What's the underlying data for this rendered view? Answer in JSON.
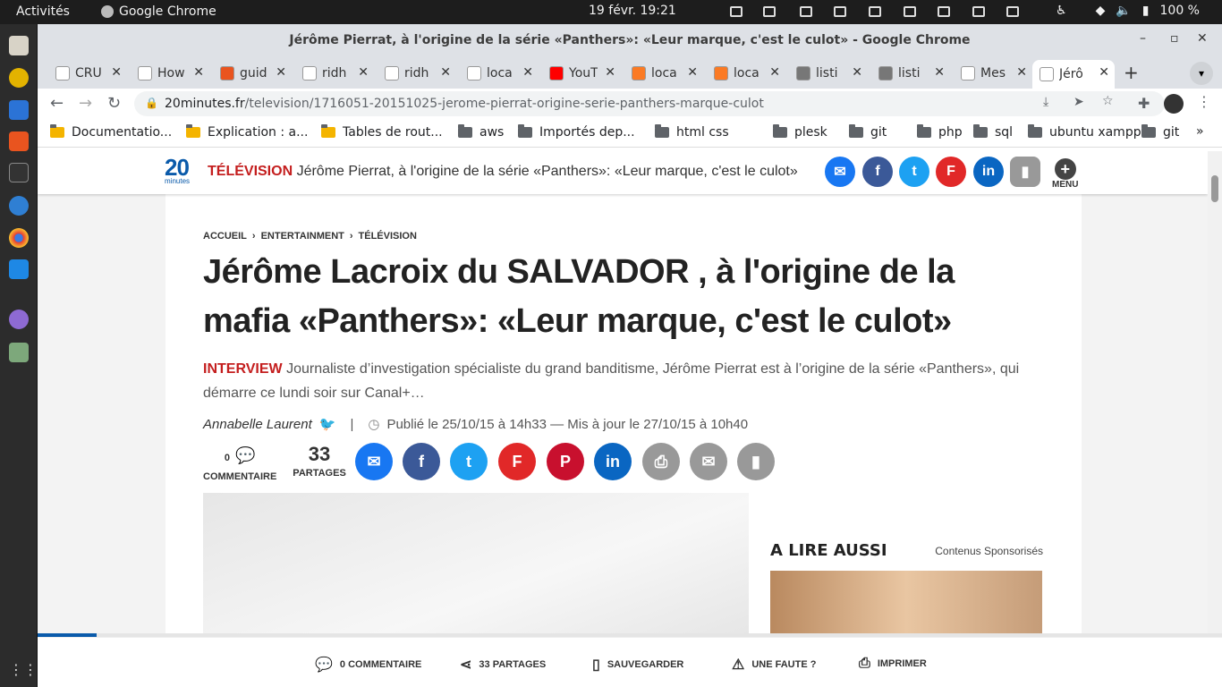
{
  "system": {
    "activities": "Activités",
    "app": "Google Chrome",
    "clock": "19 févr.  19:21",
    "battery": "100 %"
  },
  "window": {
    "title": "Jérôme Pierrat, à l'origine de la série «Panthers»: «Leur marque, c'est le culot» - Google Chrome"
  },
  "tabs": [
    {
      "label": "CRU",
      "icon": "O"
    },
    {
      "label": "How",
      "icon": "UT"
    },
    {
      "label": "guid",
      "icon": "ubuntu"
    },
    {
      "label": "ridh",
      "icon": "github"
    },
    {
      "label": "ridh",
      "icon": "github"
    },
    {
      "label": "loca",
      "icon": "pma"
    },
    {
      "label": "YouT",
      "icon": "youtube"
    },
    {
      "label": "loca",
      "icon": "xampp"
    },
    {
      "label": "loca",
      "icon": "xampp"
    },
    {
      "label": "listi",
      "icon": "globe"
    },
    {
      "label": "listi",
      "icon": "globe"
    },
    {
      "label": "Mes",
      "icon": "gmail"
    },
    {
      "label": "Jérô",
      "icon": "20"
    }
  ],
  "url": {
    "domain": "20minutes.fr",
    "path": "/television/1716051-20151025-jerome-pierrat-origine-serie-panthers-marque-culot"
  },
  "bookmarks": [
    "Documentatio...",
    "Explication : a...",
    "Tables de rout...",
    "aws",
    "Importés dep...",
    "html css",
    "plesk",
    "git",
    "php",
    "sql",
    "ubuntu xampp",
    "git"
  ],
  "site": {
    "logo": "20",
    "logo_sub": "minutes",
    "section": "TÉLÉVISION",
    "section_title": "Jérôme Pierrat, à l'origine de la série «Panthers»: «Leur marque, c'est le culot»",
    "menu": "MENU"
  },
  "article": {
    "crumbs": [
      "ACCUEIL",
      "›",
      "ENTERTAINMENT",
      "›",
      "TÉLÉVISION"
    ],
    "headline": "Jérôme Lacroix du SALVADOR , à l'origine de la mafia «Panthers»: «Leur marque, c'est le culot»",
    "chapo_tag": "INTERVIEW",
    "chapo": "Journaliste d’investigation spécialiste du grand banditisme, Jérôme Pierrat est à l’origine de la série «Panthers», qui démarre ce lundi soir sur Canal+…",
    "author": "Annabelle Laurent",
    "sep": "|",
    "date": "Publié le 25/10/15 à 14h33 — Mis à jour le 27/10/15 à 10h40",
    "comments_count": "0",
    "comments_label": "COMMENTAIRE",
    "shares_count": "33",
    "shares_label": "PARTAGES"
  },
  "aside": {
    "title": "A LIRE AUSSI",
    "sponsored": "Contenus Sponsorisés"
  },
  "bottom": {
    "comments": "0 COMMENTAIRE",
    "shares": "33 PARTAGES",
    "save": "SAUVEGARDER",
    "error": "UNE FAUTE ?",
    "print": "IMPRIMER"
  },
  "progress": 0.05
}
